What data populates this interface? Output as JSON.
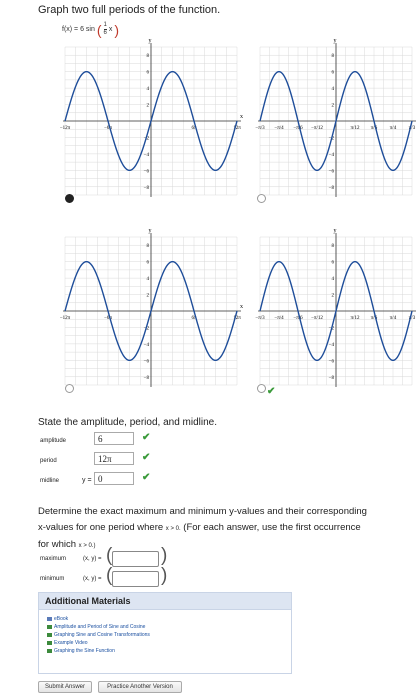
{
  "question": {
    "title": "Graph two full periods of the function.",
    "func_prefix": "f(x) = 6 sin",
    "func_num": "1",
    "func_den": "6",
    "func_var": "x"
  },
  "graphs": [
    {
      "shift": 0,
      "x_ticks": [
        "−12π",
        "−6π",
        "6π",
        "12π"
      ],
      "y_ticks": [
        "8",
        "6",
        "4",
        "2",
        "−2",
        "−4",
        "−6",
        "−8"
      ],
      "x_axis_label": "x",
      "y_axis_label": "y"
    },
    {
      "shift": 0,
      "x_ticks": [
        "−π/3",
        "−π/4",
        "−π/6",
        "−π/12",
        "π/12",
        "π/6",
        "π/4",
        "π/3"
      ],
      "y_ticks": [
        "8",
        "6",
        "4",
        "2",
        "−2",
        "−4",
        "−6",
        "−8"
      ],
      "x_axis_label": "",
      "y_axis_label": "y"
    },
    {
      "shift": 0,
      "x_ticks": [
        "−12π",
        "−6π",
        "6π",
        "12π"
      ],
      "y_ticks": [
        "8",
        "6",
        "4",
        "2",
        "−2",
        "−4",
        "−6",
        "−8"
      ],
      "x_axis_label": "x",
      "y_axis_label": "y"
    },
    {
      "shift": 0,
      "x_ticks": [
        "−π/3",
        "−π/4",
        "−π/6",
        "−π/12",
        "π/12",
        "π/6",
        "π/4",
        "π/3"
      ],
      "y_ticks": [
        "8",
        "6",
        "4",
        "2",
        "−2",
        "−4",
        "−6",
        "−8"
      ],
      "x_axis_label": "",
      "y_axis_label": "y"
    }
  ],
  "state": {
    "heading": "State the amplitude, period, and midline.",
    "amplitude_label": "amplitude",
    "amplitude_value": "6",
    "period_label": "period",
    "period_value": "12π",
    "midline_label": "midline",
    "midline_prefix": "y =",
    "midline_value": "0"
  },
  "determine": {
    "line1": "Determine the exact maximum and minimum y-values and their corresponding",
    "line2a": "x-values for one period where",
    "line2_cond": "x > 0.",
    "line2b": "(For each answer, use the first occurrence",
    "line3a": "for which",
    "line3_cond": "x > 0.)",
    "maximum_label": "maximum",
    "minimum_label": "minimum",
    "xy": "(x, y) ="
  },
  "materials": {
    "header": "Additional Materials",
    "items": [
      "eBook",
      "Amplitude and Period of Sine and Cosine",
      "Graphing Sine and Cosine Transformations",
      "Example Video",
      "Graphing the Sine Function"
    ]
  },
  "buttons": {
    "submit": "Submit Answer",
    "practice": "Practice Another Version"
  },
  "colors": {
    "curve": "#1f4e9a",
    "grid": "#d9d9d9",
    "check": "#3a9a3a"
  }
}
